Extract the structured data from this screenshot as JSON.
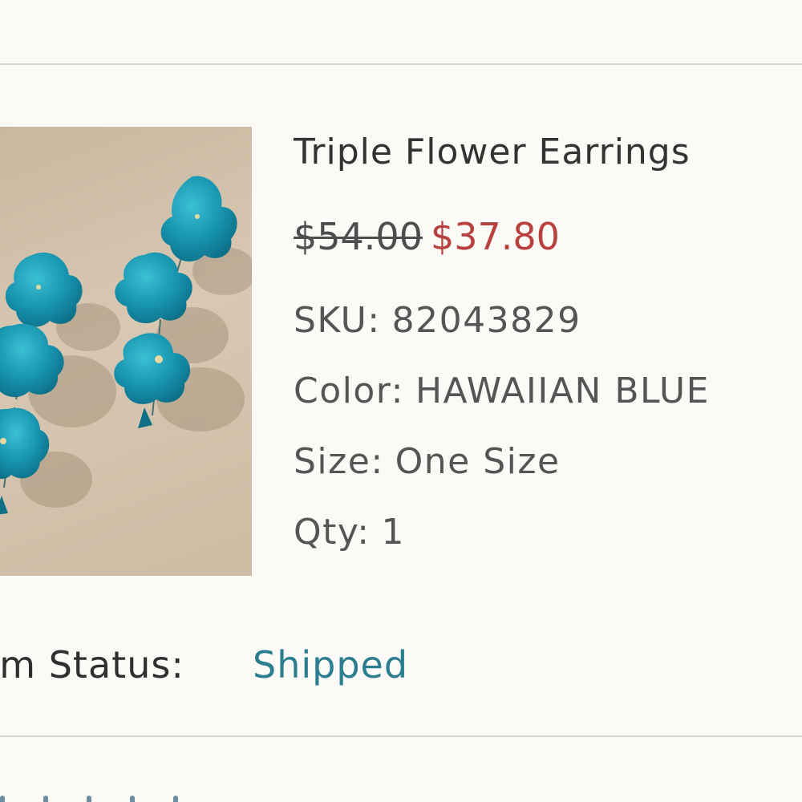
{
  "item": {
    "title": "Triple Flower Earrings",
    "price_original": "$54.00",
    "price_sale": "$37.80",
    "sku_label": "SKU:",
    "sku_value": "82043829",
    "color_label": "Color:",
    "color_value": "HAWAIIAN BLUE",
    "size_label": "Size:",
    "size_value": "One Size",
    "qty_label": "Qty:",
    "qty_value": "1"
  },
  "status": {
    "label": "em Status:",
    "value": "Shipped"
  },
  "colors": {
    "sale_price": "#b8413f",
    "status_value": "#2a7e90",
    "flower": "#1b8fa8"
  },
  "image": {
    "icon": "product-photo"
  }
}
